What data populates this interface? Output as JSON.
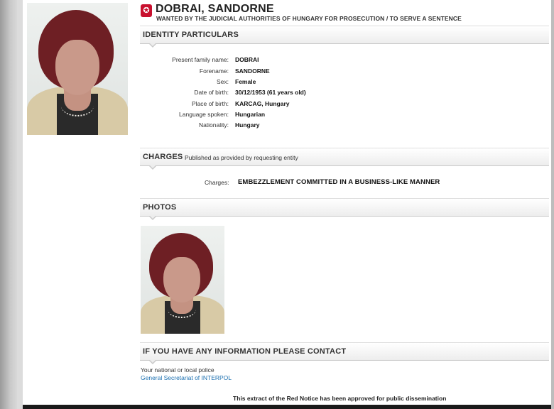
{
  "header": {
    "name": "DOBRAI, SANDORNE",
    "subtitle": "WANTED BY THE JUDICIAL AUTHORITIES OF HUNGARY FOR PROSECUTION / TO SERVE A SENTENCE",
    "seal_icon": "interpol-seal-icon"
  },
  "identity": {
    "title": "IDENTITY PARTICULARS",
    "rows": [
      {
        "label": "Present family name:",
        "value": "DOBRAI"
      },
      {
        "label": "Forename:",
        "value": "SANDORNE"
      },
      {
        "label": "Sex:",
        "value": "Female"
      },
      {
        "label": "Date of birth:",
        "value": "30/12/1953 (61 years old)"
      },
      {
        "label": "Place of birth:",
        "value": "KARCAG, Hungary"
      },
      {
        "label": "Language spoken:",
        "value": "Hungarian"
      },
      {
        "label": "Nationality:",
        "value": "Hungary"
      }
    ]
  },
  "charges": {
    "title": "CHARGES",
    "note": "Published as provided by requesting entity",
    "label": "Charges:",
    "value": "EMBEZZLEMENT COMMITTED IN A BUSINESS-LIKE MANNER"
  },
  "photos": {
    "title": "PHOTOS"
  },
  "contact": {
    "title": "IF YOU HAVE ANY INFORMATION PLEASE CONTACT",
    "line1": "Your national or local police",
    "link": "General Secretariat of INTERPOL"
  },
  "footer": "This extract of the Red Notice has been approved for public dissemination",
  "colors": {
    "accent_red": "#c8102e",
    "link_blue": "#1a6fb0"
  }
}
